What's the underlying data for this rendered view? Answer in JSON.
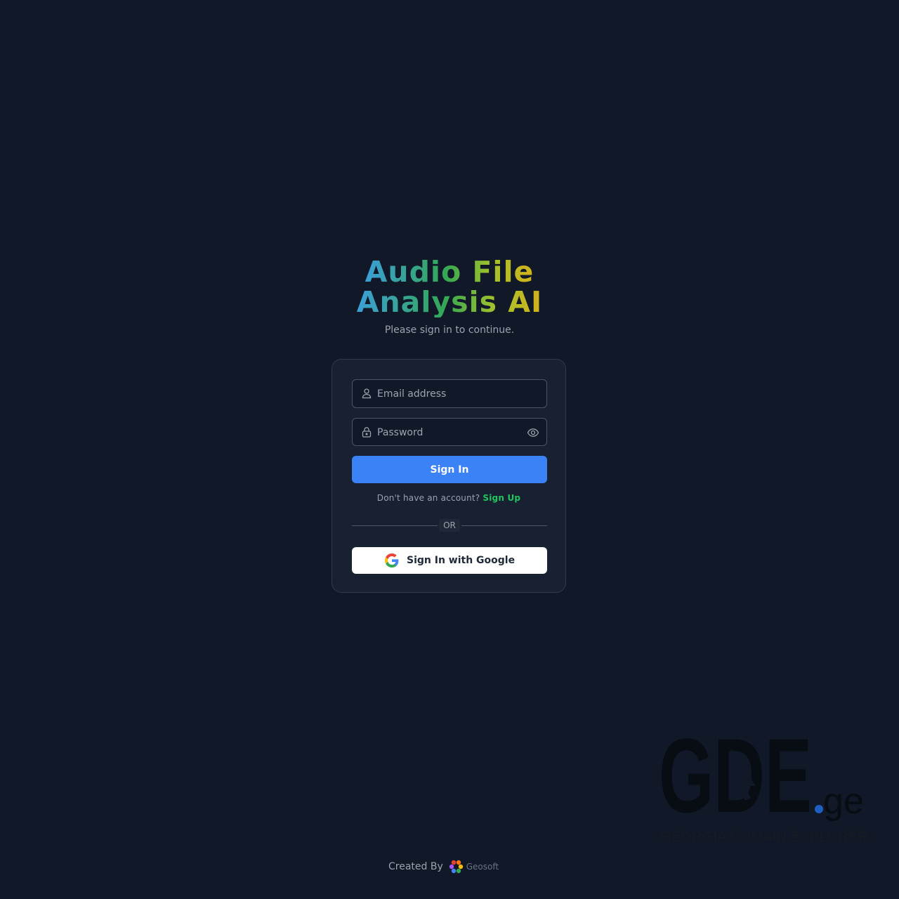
{
  "header": {
    "title_line1": "Audio File",
    "title_line2": "Analysis AI",
    "subtitle": "Please sign in to continue."
  },
  "form": {
    "email_placeholder": "Email address",
    "password_placeholder": "Password",
    "signin_label": "Sign In",
    "no_account_text": "Don't have an account?",
    "signup_label": "Sign Up",
    "divider_label": "OR",
    "google_label": "Sign In with Google"
  },
  "icons": {
    "email": "user-icon",
    "password": "lock-icon",
    "toggle": "eye-icon",
    "google": "google-logo-icon"
  },
  "footer": {
    "created_by": "Created By",
    "brand": "Geosoft"
  },
  "watermark": {
    "logo": "GDE",
    "suffix": ".ge",
    "tagline": "GEORGIA DOMAIN EXPLORER"
  },
  "colors": {
    "background": "#111827",
    "card": "#172132",
    "primary": "#3b82f6",
    "link": "#22c55e",
    "title_gradient": [
      "#3b9fd8",
      "#34a853",
      "#a3c22a",
      "#d4b21c"
    ]
  }
}
